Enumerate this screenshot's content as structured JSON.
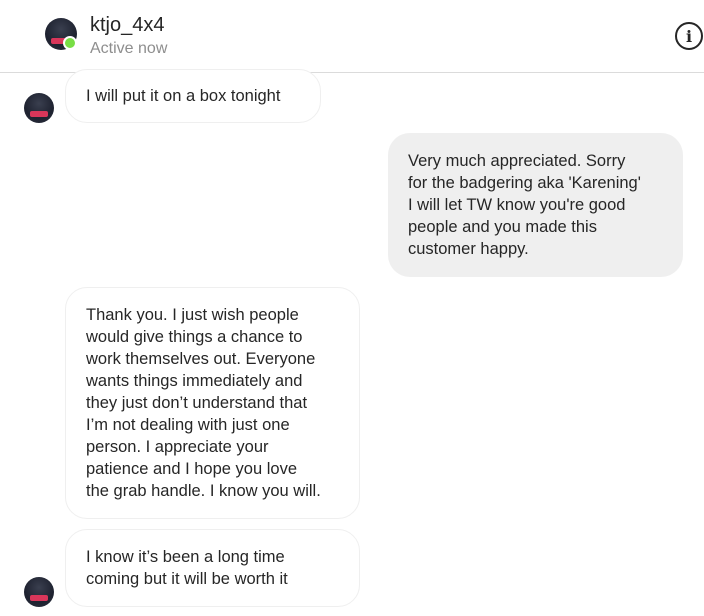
{
  "header": {
    "username": "ktjo_4x4",
    "status": "Active now",
    "info_icon": "i"
  },
  "messages": [
    {
      "direction": "incoming",
      "lines": [
        "I will put it on a box tonight"
      ]
    },
    {
      "direction": "outgoing",
      "lines": [
        "Very much appreciated. Sorry",
        "for the badgering aka 'Karening'",
        "I will let TW know you're good",
        "people and you made this",
        "customer happy."
      ]
    },
    {
      "direction": "incoming",
      "lines": [
        "Thank you. I just wish people",
        "would give things a chance to",
        "work themselves out. Everyone",
        "wants things immediately and",
        "they just don’t understand that",
        "I’m not dealing with just one",
        "person. I appreciate your",
        "patience and I hope you love",
        "the grab handle. I know you will."
      ]
    },
    {
      "direction": "incoming",
      "lines": [
        "I know it’s been a long time",
        "coming but it will be worth it"
      ]
    }
  ],
  "colors": {
    "online": "#78de45",
    "outgoing_bubble": "#efefef",
    "incoming_border": "#efefef",
    "secondary_text": "#8e8e8e"
  }
}
